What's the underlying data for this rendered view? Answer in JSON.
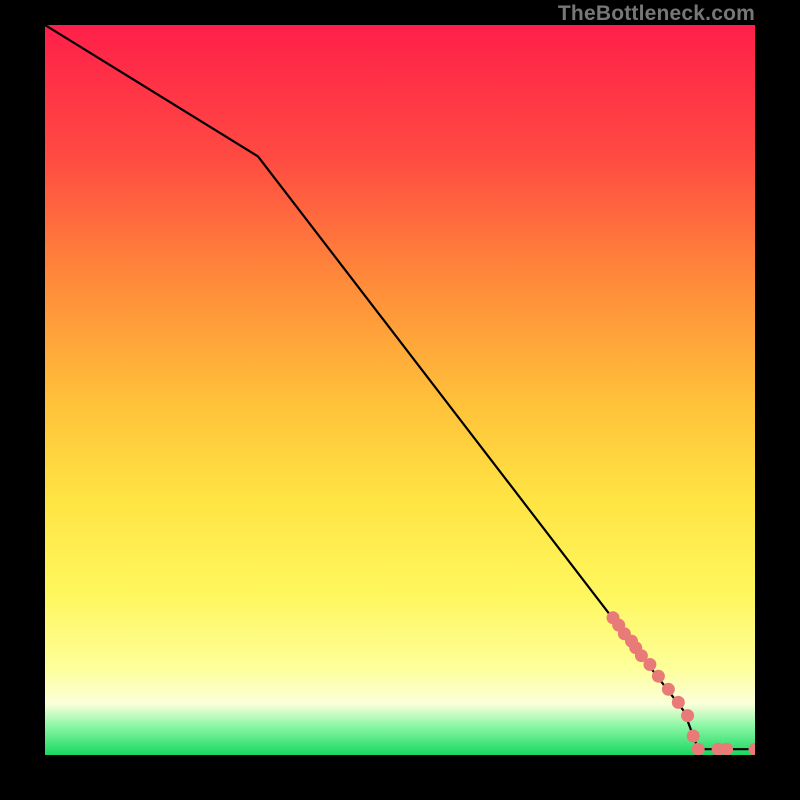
{
  "watermark": "TheBottleneck.com",
  "chart_data": {
    "type": "line",
    "title": "",
    "xlabel": "",
    "ylabel": "",
    "xlim": [
      0,
      100
    ],
    "ylim": [
      0,
      100
    ],
    "line": {
      "x": [
        0,
        30,
        90,
        92,
        100
      ],
      "y": [
        100,
        82,
        6,
        0.8,
        0.8
      ]
    },
    "markers_series": {
      "name": "points",
      "color": "#e87b78",
      "x": [
        80.0,
        80.8,
        81.6,
        82.6,
        83.2,
        84.0,
        85.2,
        86.4,
        87.8,
        89.2,
        90.5,
        91.3,
        92.0,
        94.8,
        96.0,
        100.0
      ],
      "y": [
        18.8,
        17.8,
        16.6,
        15.6,
        14.7,
        13.6,
        12.4,
        10.8,
        9.0,
        7.2,
        5.4,
        2.6,
        0.8,
        0.8,
        0.8,
        0.8
      ]
    }
  }
}
